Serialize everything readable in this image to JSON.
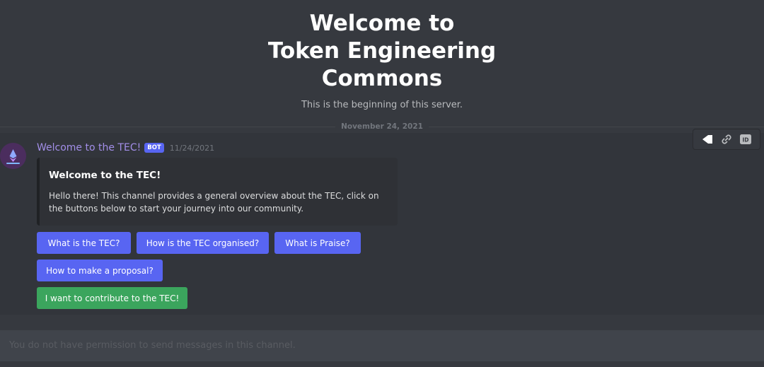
{
  "welcome": {
    "title_line1": "Welcome to",
    "title_line2": "Token Engineering",
    "title_line3": "Commons",
    "subtitle": "This is the beginning of this server."
  },
  "divider": {
    "date": "November 24, 2021"
  },
  "message": {
    "author": "Welcome to the TEC!",
    "bot_tag": "BOT",
    "timestamp": "11/24/2021",
    "avatar_icon": "tec-logo-icon",
    "embed": {
      "title": "Welcome to the TEC!",
      "description": "Hello there! This channel provides a general overview about the TEC, click on the buttons below to start your journey into our community."
    },
    "buttons": [
      {
        "label": "What is the TEC?",
        "color": "#5865f2"
      },
      {
        "label": "How is the TEC organised?",
        "color": "#5865f2"
      },
      {
        "label": "What is Praise?",
        "color": "#5865f2"
      },
      {
        "label": "How to make a proposal?",
        "color": "#5865f2"
      },
      {
        "label": "I want to contribute to the TEC!",
        "color": "#3ba55d"
      }
    ]
  },
  "toolbar": {
    "icons": [
      "reply-icon",
      "link-icon",
      "id-icon"
    ],
    "id_label": "ID"
  },
  "input": {
    "placeholder": "You do not have permission to send messages in this channel."
  },
  "colors": {
    "background": "#36393f",
    "blurple": "#5865f2",
    "green": "#3ba55d",
    "author": "#a28ee8"
  }
}
